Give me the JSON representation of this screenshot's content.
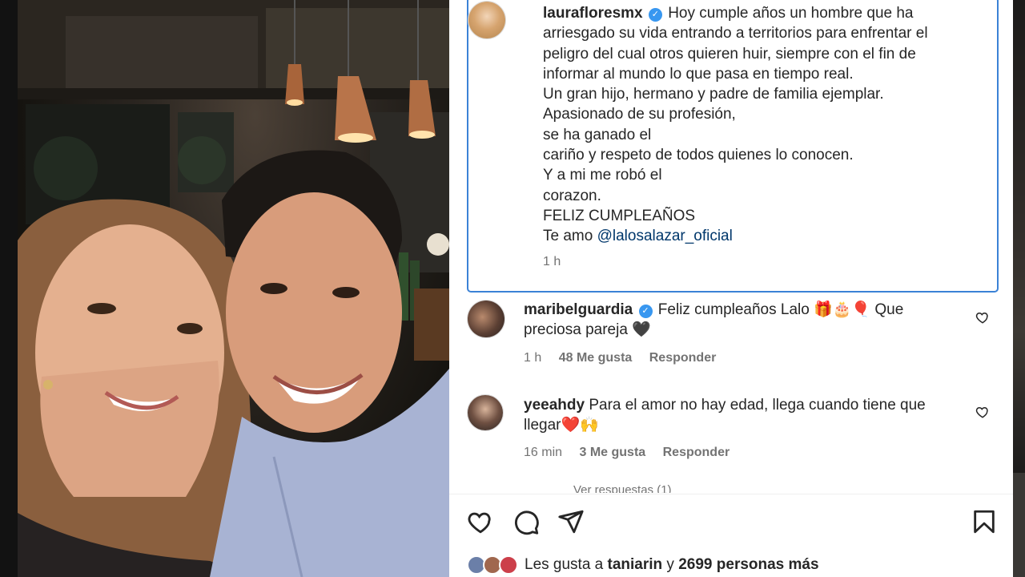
{
  "post": {
    "author": "laurafloresmx",
    "verified": true,
    "caption_lines": [
      "Hoy cumple años un hombre que ha",
      "arriesgado su vida entrando a territorios para enfrentar el",
      "peligro del cual otros quieren huir, siempre con el fin de",
      "informar al mundo lo que pasa en tiempo real.",
      "Un gran hijo, hermano y padre de familia ejemplar.",
      "Apasionado de su profesión,",
      "se ha ganado el",
      "cariño y respeto de todos quienes lo conocen.",
      "Y a mi me robó el",
      "corazon.",
      "FELIZ CUMPLEAÑOS"
    ],
    "caption_last_prefix": "Te amo ",
    "mention": "@lalosalazar_oficial",
    "time": "1 h"
  },
  "comments": [
    {
      "user": "maribelguardia",
      "verified": true,
      "text_line1": "Feliz cumpleaños Lalo 🎁🎂🎈 Que",
      "text_line2": "preciosa pareja 🖤",
      "time": "1 h",
      "likes": "48 Me gusta",
      "reply": "Responder"
    },
    {
      "user": "yeeahdy",
      "verified": false,
      "text_line1": "Para el amor no hay edad, llega cuando tiene que",
      "text_line2": "llegar❤️🙌",
      "time": "16 min",
      "likes": "3 Me gusta",
      "reply": "Responder"
    }
  ],
  "view_replies": "Ver respuestas (1)",
  "actions": {
    "like_icon": "heart-icon",
    "comment_icon": "comment-icon",
    "share_icon": "share-icon",
    "save_icon": "bookmark-icon"
  },
  "likes_summary": {
    "prefix": "Les gusta a ",
    "user": "taniarin",
    "middle": " y ",
    "count": "2699 personas más"
  },
  "colors": {
    "focus_border": "#3b82d6",
    "verified": "#3897f0",
    "mention": "#00376b",
    "muted": "#737373"
  }
}
